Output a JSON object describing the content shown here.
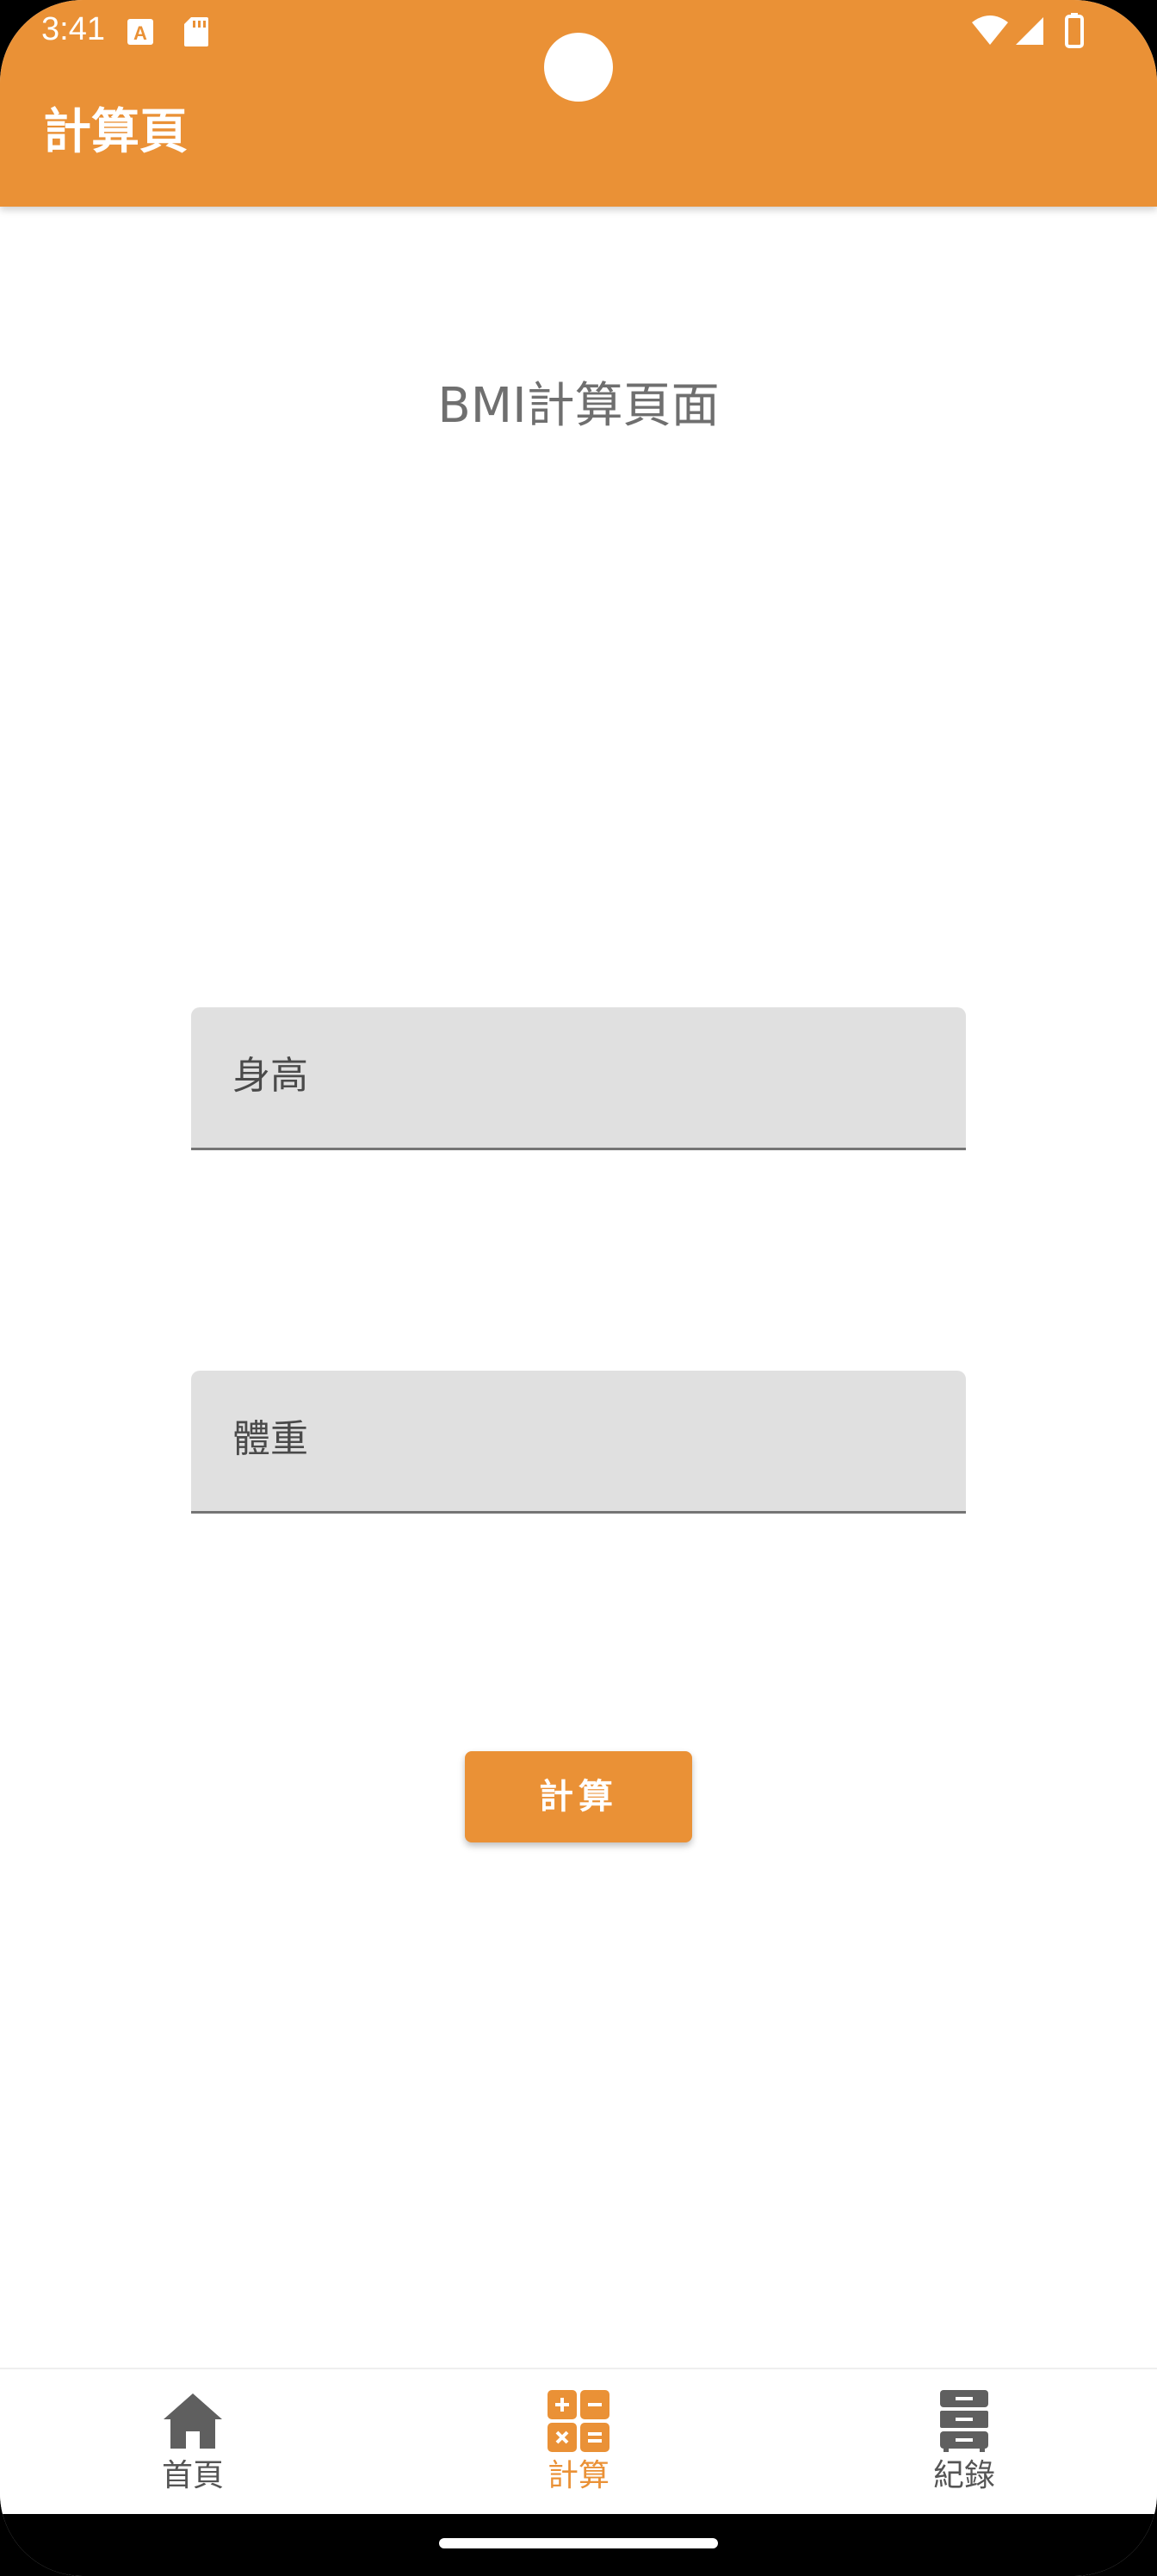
{
  "status_bar": {
    "time": "3:41",
    "icons": [
      "a-notification-icon",
      "sd-card-icon",
      "wifi-icon",
      "cellular-signal-icon",
      "battery-icon"
    ]
  },
  "app_bar": {
    "title": "計算頁",
    "background_color": "#EA9136"
  },
  "main": {
    "heading": "BMI計算頁面",
    "height_field": {
      "label": "身高",
      "value": ""
    },
    "weight_field": {
      "label": "體重",
      "value": ""
    },
    "calculate_button_label": "計算"
  },
  "bottom_nav": {
    "items": [
      {
        "label": "首頁",
        "icon": "home-icon",
        "active": false
      },
      {
        "label": "計算",
        "icon": "calculator-icon",
        "active": true
      },
      {
        "label": "紀錄",
        "icon": "file-cabinet-icon",
        "active": false
      }
    ],
    "active_color": "#EA9136",
    "inactive_color": "#555555"
  }
}
